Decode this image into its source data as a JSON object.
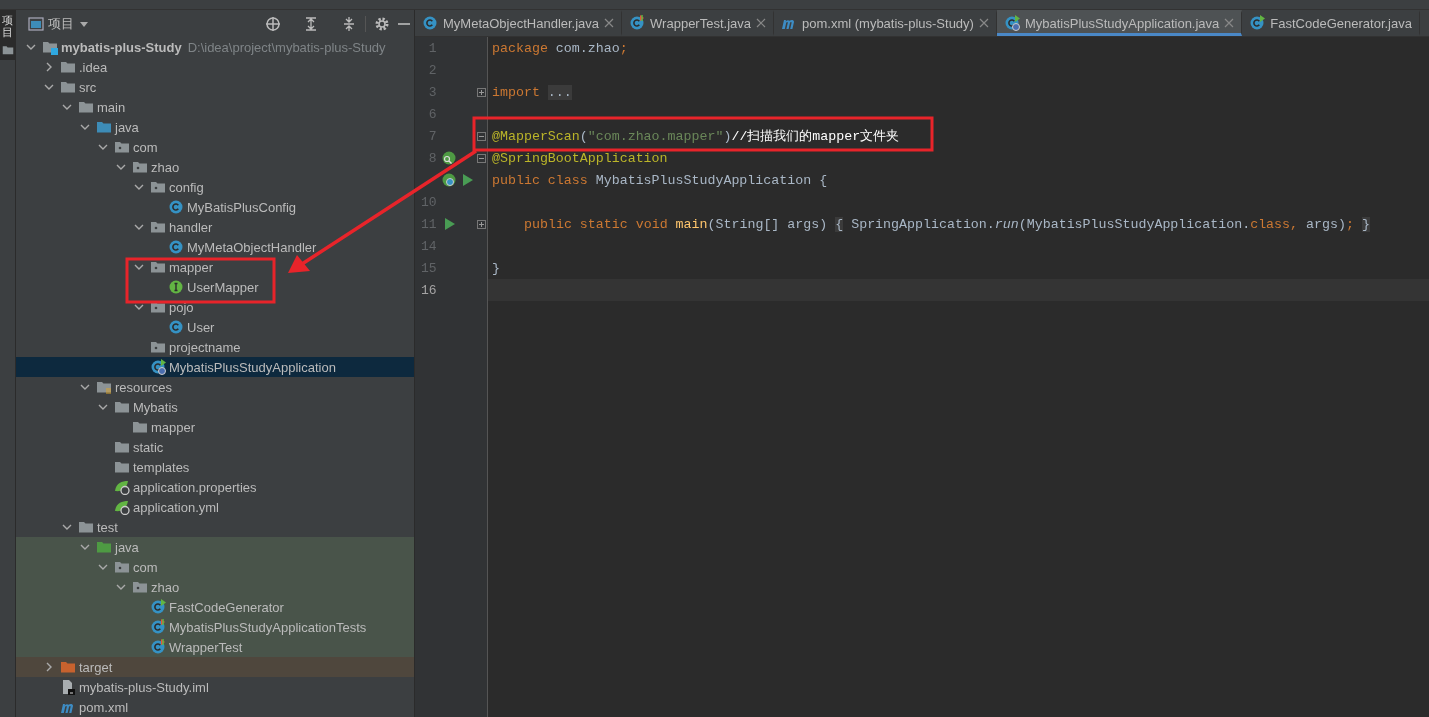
{
  "tool_stripe": {
    "label": "项目",
    "selected": true
  },
  "project_panel": {
    "title": "项目",
    "tree": [
      {
        "label": "mybatis-plus-Study",
        "path": "D:\\idea\\project\\mybatis-plus-Study",
        "kind": "module",
        "expanded": true,
        "selected": false,
        "children": [
          {
            "label": ".idea",
            "kind": "folder",
            "expanded": false,
            "selected": false
          },
          {
            "label": "src",
            "kind": "folder",
            "expanded": true,
            "selected": false,
            "children": [
              {
                "label": "main",
                "kind": "folder",
                "expanded": true,
                "selected": false,
                "children": [
                  {
                    "label": "java",
                    "kind": "source-root",
                    "expanded": true,
                    "selected": false,
                    "children": [
                      {
                        "label": "com",
                        "kind": "package",
                        "expanded": true,
                        "selected": false,
                        "children": [
                          {
                            "label": "zhao",
                            "kind": "package",
                            "expanded": true,
                            "selected": false,
                            "children": [
                              {
                                "label": "config",
                                "kind": "package",
                                "expanded": true,
                                "selected": false,
                                "children": [
                                  {
                                    "label": "MyBatisPlusConfig",
                                    "kind": "class",
                                    "selected": false
                                  }
                                ]
                              },
                              {
                                "label": "handler",
                                "kind": "package",
                                "expanded": true,
                                "selected": false,
                                "children": [
                                  {
                                    "label": "MyMetaObjectHandler",
                                    "kind": "class",
                                    "selected": false
                                  }
                                ]
                              },
                              {
                                "label": "mapper",
                                "kind": "package",
                                "expanded": true,
                                "selected": false,
                                "children": [
                                  {
                                    "label": "UserMapper",
                                    "kind": "interface",
                                    "selected": false
                                  }
                                ]
                              },
                              {
                                "label": "pojo",
                                "kind": "package",
                                "expanded": true,
                                "selected": false,
                                "children": [
                                  {
                                    "label": "User",
                                    "kind": "class",
                                    "selected": false
                                  }
                                ]
                              },
                              {
                                "label": "projectname",
                                "kind": "package",
                                "selected": false
                              },
                              {
                                "label": "MybatisPlusStudyApplication",
                                "kind": "app-class",
                                "selected": true
                              }
                            ]
                          }
                        ]
                      }
                    ]
                  },
                  {
                    "label": "resources",
                    "kind": "resources-root",
                    "expanded": true,
                    "selected": false,
                    "children": [
                      {
                        "label": "Mybatis",
                        "kind": "folder",
                        "expanded": true,
                        "selected": false,
                        "children": [
                          {
                            "label": "mapper",
                            "kind": "folder",
                            "selected": false
                          }
                        ]
                      },
                      {
                        "label": "static",
                        "kind": "folder",
                        "selected": false
                      },
                      {
                        "label": "templates",
                        "kind": "folder",
                        "selected": false
                      },
                      {
                        "label": "application.properties",
                        "kind": "spring-config",
                        "selected": false
                      },
                      {
                        "label": "application.yml",
                        "kind": "spring-config",
                        "selected": false
                      }
                    ]
                  }
                ]
              },
              {
                "label": "test",
                "kind": "folder",
                "expanded": true,
                "selected": false,
                "children": [
                  {
                    "label": "java",
                    "kind": "test-root",
                    "test_scope": true,
                    "expanded": true,
                    "selected": false,
                    "children": [
                      {
                        "label": "com",
                        "kind": "package",
                        "expanded": true,
                        "selected": false,
                        "children": [
                          {
                            "label": "zhao",
                            "kind": "package",
                            "expanded": true,
                            "selected": false,
                            "children": [
                              {
                                "label": "FastCodeGenerator",
                                "kind": "run-class",
                                "selected": false
                              },
                              {
                                "label": "MybatisPlusStudyApplicationTests",
                                "kind": "test-class",
                                "selected": false
                              },
                              {
                                "label": "WrapperTest",
                                "kind": "test-class",
                                "selected": false
                              }
                            ]
                          }
                        ]
                      }
                    ]
                  }
                ]
              }
            ]
          },
          {
            "label": "target",
            "kind": "excluded",
            "expanded": false,
            "selected": false
          },
          {
            "label": "mybatis-plus-Study.iml",
            "kind": "iml",
            "selected": false
          },
          {
            "label": "pom.xml",
            "kind": "maven",
            "selected": false
          }
        ]
      }
    ]
  },
  "editor": {
    "tabs": [
      {
        "label": "MyMetaObjectHandler.java",
        "kind": "class",
        "selected": false,
        "closable": true
      },
      {
        "label": "WrapperTest.java",
        "kind": "test-class",
        "selected": false,
        "closable": true
      },
      {
        "label": "pom.xml (mybatis-plus-Study)",
        "kind": "maven",
        "selected": false,
        "closable": true
      },
      {
        "label": "MybatisPlusStudyApplication.java",
        "kind": "app-class",
        "selected": true,
        "closable": true
      },
      {
        "label": "FastCodeGenerator.java",
        "kind": "run-class",
        "selected": false,
        "closable": false
      }
    ],
    "lines": [
      {
        "number": "1",
        "indented": false,
        "current": false,
        "tokens": [
          {
            "kind": "keyword",
            "text": "package"
          },
          {
            "kind": "plain",
            "text": " com.zhao"
          },
          {
            "kind": "keyword",
            "text": ";"
          }
        ]
      },
      {
        "number": "2",
        "current": false
      },
      {
        "number": "3",
        "indented": false,
        "current": false,
        "folded": true,
        "tokens": [
          {
            "kind": "keyword",
            "text": "import "
          },
          {
            "kind": "folded",
            "text": "..."
          }
        ]
      },
      {
        "number": "6",
        "current": false
      },
      {
        "number": "7",
        "indented": false,
        "current": false,
        "fold_start": true,
        "tokens": [
          {
            "kind": "annotation",
            "text": "@MapperScan"
          },
          {
            "kind": "plain",
            "text": "("
          },
          {
            "kind": "string",
            "text": "\"com.zhao.mapper\""
          },
          {
            "kind": "plain",
            "text": ")"
          },
          {
            "kind": "comment",
            "text": "//扫描我们的mapper文件夹"
          }
        ]
      },
      {
        "number": "8",
        "indented": false,
        "current": false,
        "fold_start": true,
        "spring_bean": true,
        "tokens": [
          {
            "kind": "annotation",
            "text": "@SpringBootApplication"
          }
        ]
      },
      {
        "indented": false,
        "current": false,
        "spring_app": true,
        "runnable": true,
        "tokens": [
          {
            "kind": "keyword",
            "text": "public class "
          },
          {
            "kind": "plain",
            "text": "MybatisPlusStudyApplication {"
          }
        ]
      },
      {
        "number": "10",
        "current": false
      },
      {
        "number": "11",
        "indented": true,
        "current": false,
        "folded": true,
        "runnable": true,
        "tokens": [
          {
            "kind": "keyword",
            "text": "public static void "
          },
          {
            "kind": "method",
            "text": "main"
          },
          {
            "kind": "plain",
            "text": "(String[] args) "
          },
          {
            "kind": "folded",
            "text": "{"
          },
          {
            "kind": "plain",
            "text": " SpringApplication."
          },
          {
            "kind": "static-call",
            "text": "run"
          },
          {
            "kind": "plain",
            "text": "(MybatisPlusStudyApplication."
          },
          {
            "kind": "keyword",
            "text": "class, "
          },
          {
            "kind": "plain",
            "text": "args)"
          },
          {
            "kind": "keyword",
            "text": "; "
          },
          {
            "kind": "folded",
            "text": "}"
          }
        ]
      },
      {
        "number": "14",
        "current": false
      },
      {
        "number": "15",
        "indented": false,
        "current": false,
        "tokens": [
          {
            "kind": "plain",
            "text": "}"
          }
        ]
      },
      {
        "number": "16",
        "current": true
      }
    ]
  }
}
